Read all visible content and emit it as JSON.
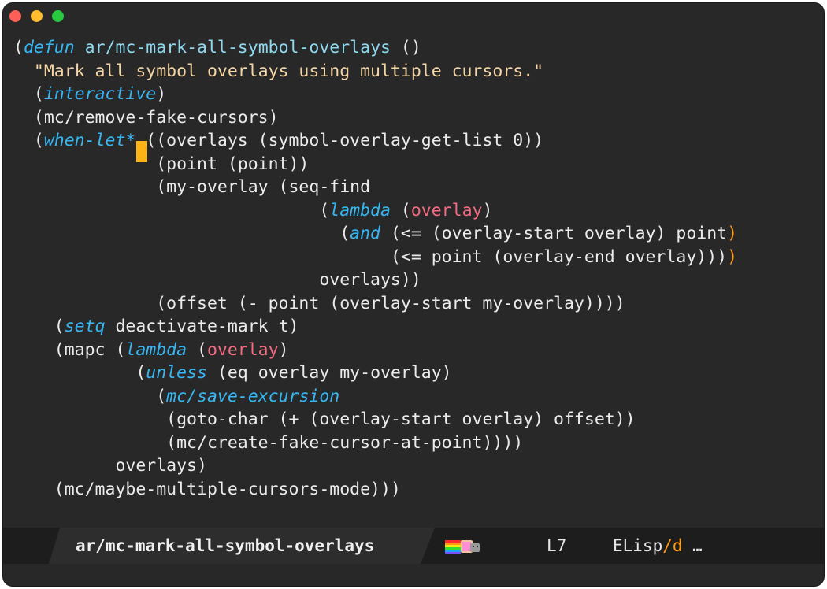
{
  "window": {
    "traffic_lights": [
      "close",
      "minimize",
      "zoom"
    ],
    "colors": {
      "close": "#ff5f57",
      "minimize": "#febc2e",
      "zoom": "#28c840",
      "background": "#282828"
    }
  },
  "editor": {
    "lines": [
      {
        "indent": "",
        "segments": [
          {
            "t": "(",
            "c": "p"
          },
          {
            "t": "defun",
            "c": "kw"
          },
          {
            "t": " ",
            "c": "p"
          },
          {
            "t": "ar/mc-mark-all-symbol-overlays",
            "c": "fn"
          },
          {
            "t": " ()",
            "c": "p"
          }
        ]
      },
      {
        "indent": "  ",
        "segments": [
          {
            "t": "\"Mark all symbol overlays using multiple cursors.\"",
            "c": "str"
          }
        ]
      },
      {
        "indent": "  ",
        "segments": [
          {
            "t": "(",
            "c": "p"
          },
          {
            "t": "interactive",
            "c": "kw"
          },
          {
            "t": ")",
            "c": "p"
          }
        ]
      },
      {
        "indent": "  ",
        "segments": [
          {
            "t": "(mc/remove-fake-cursors)",
            "c": "p"
          }
        ]
      },
      {
        "indent": "  ",
        "segments": [
          {
            "t": "(",
            "c": "p"
          },
          {
            "t": "when-let*",
            "c": "kw"
          },
          {
            "t": " ((overlays (symbol-overlay-get-list 0))",
            "c": "p"
          }
        ]
      },
      {
        "indent": "              ",
        "segments": [
          {
            "t": "(point (point))",
            "c": "p"
          }
        ]
      },
      {
        "indent": "              ",
        "segments": [
          {
            "t": "(my-overlay (seq-find",
            "c": "p"
          }
        ]
      },
      {
        "indent": "                              ",
        "segments": [
          {
            "t": "(",
            "c": "p"
          },
          {
            "t": "lambda",
            "c": "kw"
          },
          {
            "t": " (",
            "c": "p"
          },
          {
            "t": "overlay",
            "c": "param"
          },
          {
            "t": ")",
            "c": "p"
          }
        ]
      },
      {
        "indent": "                                ",
        "segments": [
          {
            "t": "(",
            "c": "p"
          },
          {
            "t": "and",
            "c": "kw"
          },
          {
            "t": " (<= (overlay-start overlay) point",
            "c": "p"
          },
          {
            "t": ")",
            "c": "hl"
          }
        ]
      },
      {
        "indent": "                                     ",
        "segments": [
          {
            "t": "(<= point (overlay-end overlay)))",
            "c": "p"
          },
          {
            "t": ")",
            "c": "hl"
          }
        ]
      },
      {
        "indent": "                              ",
        "segments": [
          {
            "t": "overlays))",
            "c": "p"
          }
        ]
      },
      {
        "indent": "              ",
        "segments": [
          {
            "t": "(offset (- point (overlay-start my-overlay))))",
            "c": "p"
          }
        ]
      },
      {
        "indent": "    ",
        "segments": [
          {
            "t": "(",
            "c": "p"
          },
          {
            "t": "setq",
            "c": "kw"
          },
          {
            "t": " deactivate-mark t)",
            "c": "p"
          }
        ]
      },
      {
        "indent": "    ",
        "segments": [
          {
            "t": "(mapc (",
            "c": "p"
          },
          {
            "t": "lambda",
            "c": "kw"
          },
          {
            "t": " (",
            "c": "p"
          },
          {
            "t": "overlay",
            "c": "param"
          },
          {
            "t": ")",
            "c": "p"
          }
        ]
      },
      {
        "indent": "            ",
        "segments": [
          {
            "t": "(",
            "c": "p"
          },
          {
            "t": "unless",
            "c": "kw"
          },
          {
            "t": " (eq overlay my-overlay)",
            "c": "p"
          }
        ]
      },
      {
        "indent": "              ",
        "segments": [
          {
            "t": "(",
            "c": "p"
          },
          {
            "t": "mc/save-excursion",
            "c": "kw"
          }
        ]
      },
      {
        "indent": "               ",
        "segments": [
          {
            "t": "(goto-char (+ (overlay-start overlay) offset))",
            "c": "p"
          }
        ]
      },
      {
        "indent": "               ",
        "segments": [
          {
            "t": "(mc/create-fake-cursor-at-point))))",
            "c": "p"
          }
        ]
      },
      {
        "indent": "          ",
        "segments": [
          {
            "t": "overlays)",
            "c": "p"
          }
        ]
      },
      {
        "indent": "    ",
        "segments": [
          {
            "t": "(mc/maybe-multiple-cursors-mode)))",
            "c": "p"
          }
        ]
      }
    ]
  },
  "modeline": {
    "buffer_name": "ar/mc-mark-all-symbol-overlays",
    "nyan_icon": "nyan-cat-icon",
    "line_number": "L7",
    "major_mode": "ELisp",
    "mode_separator": "/",
    "minor_mode": "d",
    "ellipsis": " …"
  },
  "colors": {
    "keyword": "#38b6f2",
    "function_name": "#8fd8ee",
    "string": "#f5d6a4",
    "parameter": "#f46b82",
    "paren_match": "#ff9a14",
    "cursor": "#fdb215",
    "text": "#ebebeb"
  }
}
